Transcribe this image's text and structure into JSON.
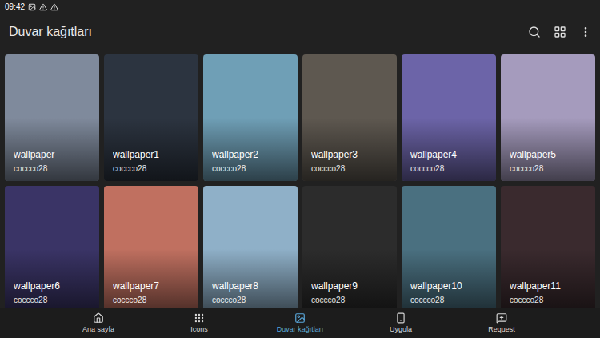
{
  "status_bar": {
    "time": "09:42"
  },
  "app_bar": {
    "title": "Duvar kağıtları"
  },
  "wallpapers": [
    {
      "name": "wallpaper",
      "author": "coccco28",
      "color": "#7f8a9c"
    },
    {
      "name": "wallpaper1",
      "author": "coccco28",
      "color": "#2c3440"
    },
    {
      "name": "wallpaper2",
      "author": "coccco28",
      "color": "#6f9fb6"
    },
    {
      "name": "wallpaper3",
      "author": "coccco28",
      "color": "#5e5850"
    },
    {
      "name": "wallpaper4",
      "author": "coccco28",
      "color": "#6c64a8"
    },
    {
      "name": "wallpaper5",
      "author": "coccco28",
      "color": "#a59bbd"
    },
    {
      "name": "wallpaper6",
      "author": "coccco28",
      "color": "#3a3466"
    },
    {
      "name": "wallpaper7",
      "author": "coccco28",
      "color": "#c07060"
    },
    {
      "name": "wallpaper8",
      "author": "coccco28",
      "color": "#8fb0c8"
    },
    {
      "name": "wallpaper9",
      "author": "coccco28",
      "color": "#2c2c2c"
    },
    {
      "name": "wallpaper10",
      "author": "coccco28",
      "color": "#4a7080"
    },
    {
      "name": "wallpaper11",
      "author": "coccco28",
      "color": "#3a2a2e"
    }
  ],
  "bottom_nav": [
    {
      "label": "Ana sayfa",
      "selected": false
    },
    {
      "label": "Icons",
      "selected": false
    },
    {
      "label": "Duvar kağıtları",
      "selected": true
    },
    {
      "label": "Uygula",
      "selected": false
    },
    {
      "label": "Request",
      "selected": false
    }
  ]
}
